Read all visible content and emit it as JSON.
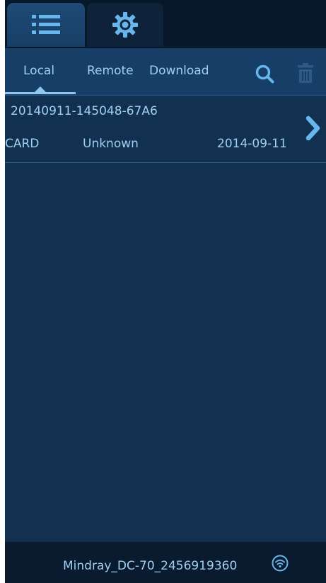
{
  "top_tabs": [
    {
      "icon": "list-icon",
      "selected": true
    },
    {
      "icon": "gear-icon",
      "selected": false
    }
  ],
  "sub_tabs": {
    "local": "Local",
    "remote": "Remote",
    "download": "Download",
    "selected": "Local"
  },
  "toolbar": {
    "search_icon": "search-icon",
    "delete_icon": "trash-icon"
  },
  "records": [
    {
      "name": "20140911-145048-67A6",
      "source": "CARD",
      "status": "Unknown",
      "date": "2014-09-11"
    }
  ],
  "bottom_bar": {
    "device_name": "Mindray_DC-70_2456919360",
    "connection_icon": "wifi-icon"
  },
  "colors": {
    "background": "#12304f",
    "tab_bar": "#173e66",
    "text": "#9fd0f2",
    "icon": "#67b7ee"
  }
}
